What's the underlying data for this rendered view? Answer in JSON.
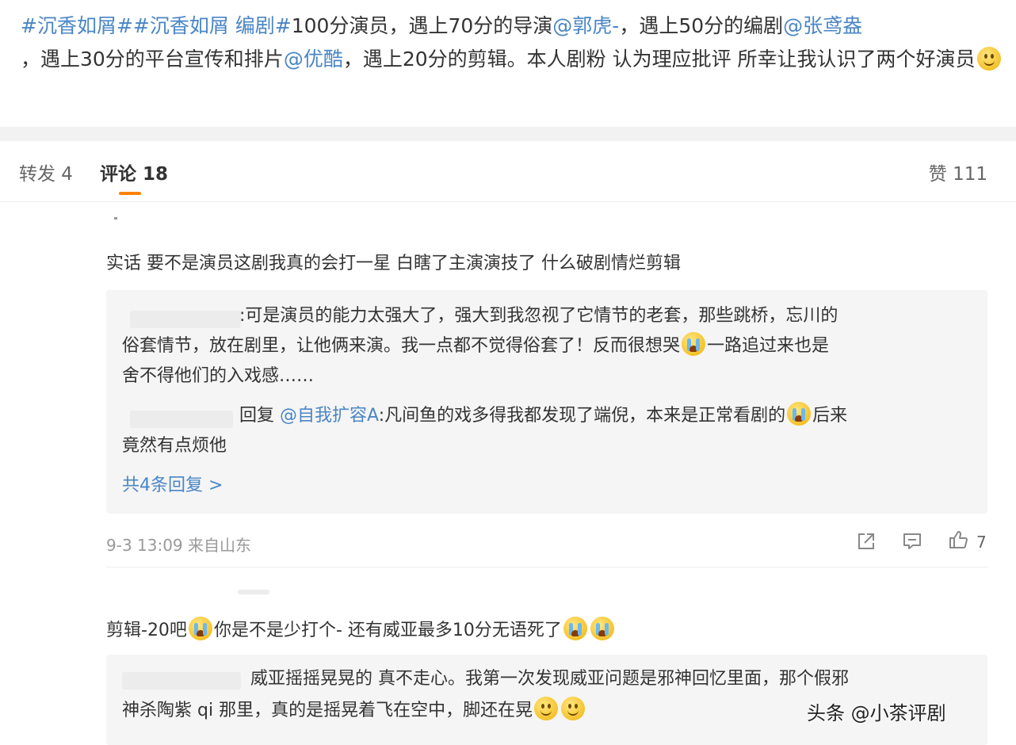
{
  "post": {
    "segments": [
      {
        "text": "#沉香如屑##沉香如屑 编剧#",
        "link": true
      },
      {
        "text": "100分演员，遇上70分的导演",
        "link": false
      },
      {
        "text": "@郭虎-",
        "link": true
      },
      {
        "text": "，遇上50分的编剧",
        "link": false
      },
      {
        "text": "@张鸢盎",
        "link": true
      },
      {
        "text": "，遇上30分的平台宣传和排片",
        "link": false
      },
      {
        "text": "@优酷",
        "link": true
      },
      {
        "text": "，遇上20分的剪辑。本人剧粉 认为理应批评 所幸让我认识了两个好演员",
        "link": false
      }
    ],
    "end_emoji": "smile"
  },
  "tabs": {
    "repost": "转发 4",
    "comments": "评论 18",
    "likes": "赞 111"
  },
  "comment1": {
    "text": "实话 要不是演员这剧我真的会打一星 白瞎了主演演技了 什么破剧情烂剪辑",
    "reply1": {
      "line1": ":可是演员的能力太强大了，强大到我忽视了它情节的老套，那些跳桥，忘川的",
      "line2a": "俗套情节，放在剧里，让他俩来演。我一点都不觉得俗套了！反而很想哭",
      "line2b": "一路追过来也是",
      "line3": "舍不得他们的入戏感……"
    },
    "reply2": {
      "prefix": "回复",
      "mention": "@自我扩容A",
      "line1": ":凡间鱼的戏多得我都发现了端倪，本来是正常看剧的",
      "line1b": "后来",
      "line2": "竟然有点烦他"
    },
    "more_replies": "共4条回复 >",
    "meta": "9-3 13:09 来自山东",
    "like_count": "7"
  },
  "comment2": {
    "text_a": "剪辑-20吧",
    "text_b": "你是不是少打个- 还有威亚最多10分无语死了",
    "reply1": {
      "line1": "威亚摇摇晃晃的 真不走心。我第一次发现威亚问题是邪神回忆里面，那个假邪",
      "line2": "神杀陶紫 qi 那里，真的是摇晃着飞在空中，脚还在晃"
    }
  },
  "watermark": "头条 @小茶评剧",
  "colors": {
    "link": "#4a86c5",
    "tab_underline": "#ff8200",
    "background": "#f2f2f2"
  }
}
